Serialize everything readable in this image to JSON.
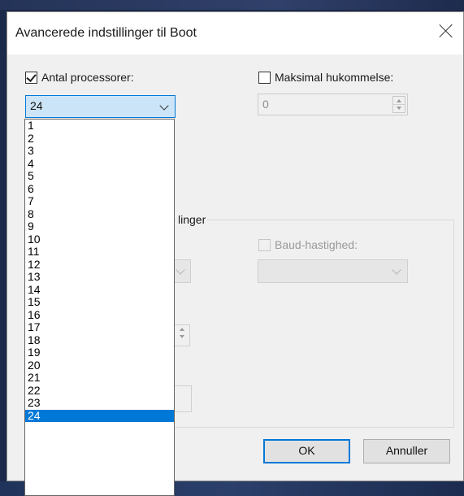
{
  "dialog": {
    "title": "Avancerede indstillinger til Boot"
  },
  "processors": {
    "label": "Antal processorer:",
    "checked": true,
    "value": "24",
    "options": [
      "1",
      "2",
      "3",
      "4",
      "5",
      "6",
      "7",
      "8",
      "9",
      "10",
      "11",
      "12",
      "13",
      "14",
      "15",
      "16",
      "17",
      "18",
      "19",
      "20",
      "21",
      "22",
      "23",
      "24"
    ],
    "selected": "24"
  },
  "memory": {
    "label": "Maksimal hukommelse:",
    "checked": false,
    "value": "0"
  },
  "debug": {
    "group_title_partial": "linger",
    "baud_label": "Baud-hastighed:",
    "baud_checked": false
  },
  "buttons": {
    "ok": "OK",
    "cancel": "Annuller"
  },
  "colors": {
    "accent": "#0078d7",
    "selection": "#0078d7",
    "combo_focus_bg": "#cce4f7"
  }
}
